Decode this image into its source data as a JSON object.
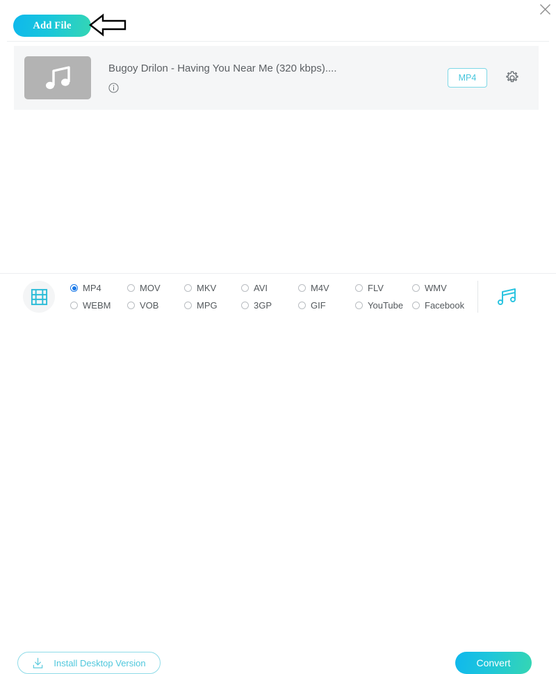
{
  "window": {
    "close_label": "×"
  },
  "toolbar": {
    "add_file_label": "Add File",
    "hint_arrow": "left-arrow-annotation"
  },
  "file_list": {
    "items": [
      {
        "title": "Bugoy Drilon - Having You Near Me (320 kbps)....",
        "thumb_icon": "music-note-icon",
        "info_icon": "info-icon",
        "format_badge": "MP4",
        "settings_icon": "gear-icon"
      }
    ]
  },
  "format_bar": {
    "video_icon": "film-strip-icon",
    "audio_icon": "music-note-icon",
    "selected": "MP4",
    "options": [
      "MP4",
      "MOV",
      "MKV",
      "AVI",
      "M4V",
      "FLV",
      "WMV",
      "WEBM",
      "VOB",
      "MPG",
      "3GP",
      "GIF",
      "YouTube",
      "Facebook"
    ]
  },
  "footer": {
    "install_label": "Install Desktop Version",
    "install_icon": "download-icon",
    "convert_label": "Convert"
  },
  "colors": {
    "accent_start": "#0eb8ec",
    "accent_end": "#34d6b4",
    "cyan": "#46c6dd",
    "radio_checked": "#1878e8",
    "row_bg": "#f5f6f7",
    "thumb_bg": "#b3b3b3",
    "text": "#53585c"
  }
}
